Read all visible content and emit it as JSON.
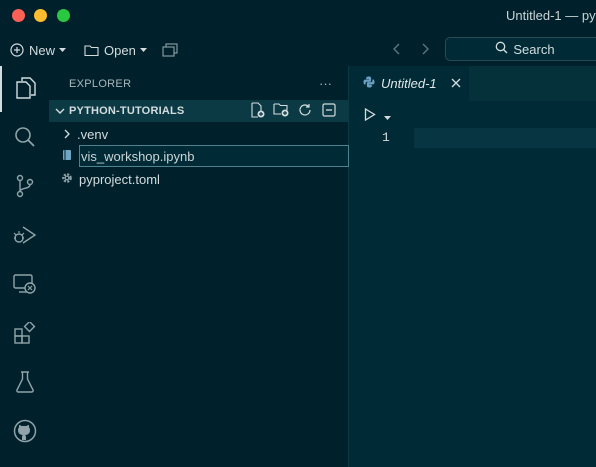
{
  "window": {
    "title": "Untitled-1 — pyt"
  },
  "toolbar": {
    "new_label": "New",
    "open_label": "Open",
    "search_label": "Search"
  },
  "sidebar": {
    "header": "EXPLORER",
    "more_label": "···",
    "folder_name": "PYTHON-TUTORIALS",
    "items": [
      {
        "label": ".venv",
        "type": "folder"
      },
      {
        "label": "pyproject.toml",
        "type": "file"
      }
    ],
    "rename_value": "vis_workshop.ipynb"
  },
  "editor": {
    "tab_label": "Untitled-1",
    "line_numbers": [
      "1"
    ]
  },
  "icons": {
    "activity_bar": [
      "files-icon",
      "search-icon",
      "source-control-icon",
      "run-debug-icon",
      "remote-explorer-icon",
      "extensions-icon",
      "testing-icon",
      "github-icon"
    ]
  },
  "colors": {
    "background": "#002b36",
    "chrome": "#00212b",
    "accent": "#4a8290"
  }
}
